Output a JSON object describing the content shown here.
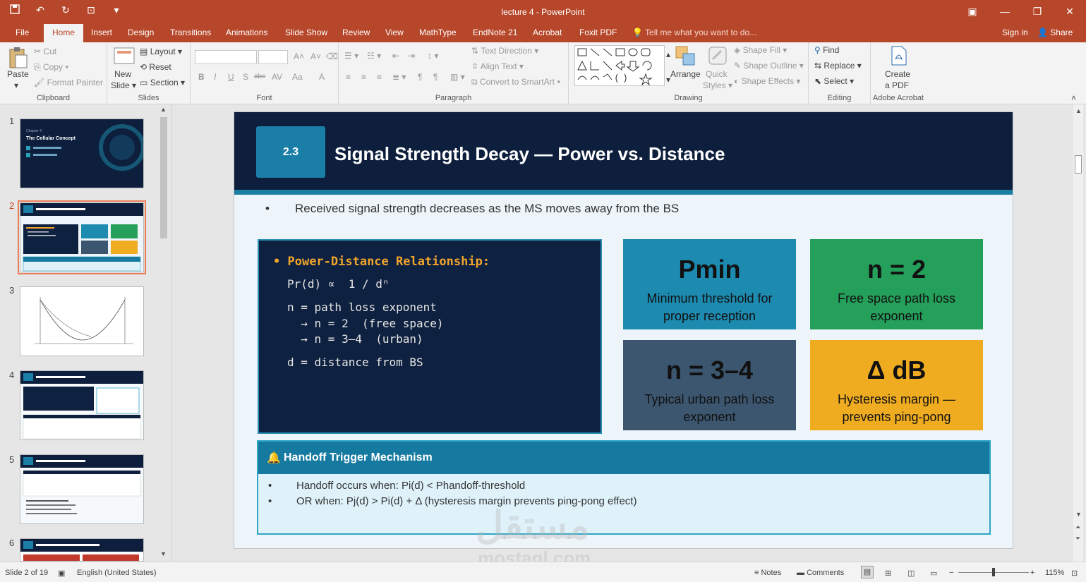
{
  "titlebar": {
    "title": "lecture 4 - PowerPoint",
    "qat": [
      "save-icon",
      "undo-icon",
      "redo-icon",
      "present-icon",
      "customize-icon"
    ]
  },
  "tabs": {
    "items": [
      "File",
      "Home",
      "Insert",
      "Design",
      "Transitions",
      "Animations",
      "Slide Show",
      "Review",
      "View",
      "MathType",
      "EndNote 21",
      "Acrobat",
      "Foxit PDF"
    ],
    "active": "Home",
    "tell_me": "Tell me what you want to do...",
    "sign_in": "Sign in",
    "share": "Share"
  },
  "ribbon": {
    "clipboard": {
      "paste": "Paste",
      "cut": "Cut",
      "copy": "Copy",
      "format_painter": "Format Painter",
      "label": "Clipboard"
    },
    "slides": {
      "new_slide": "New",
      "new_slide2": "Slide",
      "layout": "Layout",
      "reset": "Reset",
      "section": "Section",
      "label": "Slides"
    },
    "font": {
      "label": "Font",
      "b": "B",
      "i": "I",
      "u": "U",
      "s": "S",
      "abc": "abc",
      "av": "AV",
      "aa": "Aa",
      "a": "A"
    },
    "paragraph": {
      "text_direction": "Text Direction",
      "align_text": "Align Text",
      "convert": "Convert to SmartArt",
      "label": "Paragraph"
    },
    "drawing": {
      "arrange": "Arrange",
      "quick": "Quick",
      "styles": "Styles",
      "shape_fill": "Shape Fill",
      "shape_outline": "Shape Outline",
      "shape_effects": "Shape Effects",
      "label": "Drawing"
    },
    "editing": {
      "find": "Find",
      "replace": "Replace",
      "select": "Select",
      "label": "Editing"
    },
    "acrobat": {
      "create": "Create",
      "pdf": "a PDF",
      "label": "Adobe Acrobat"
    }
  },
  "thumbnails": {
    "numbers": [
      "1",
      "2",
      "3",
      "4",
      "5",
      "6"
    ],
    "selected": "2",
    "t1_chapter": "Chapter 4",
    "t1_title": "The Cellular Concept"
  },
  "slide": {
    "section_no": "2.3",
    "title": "Signal Strength Decay — Power vs. Distance",
    "bullet": "Received signal strength decreases as the MS moves away from the BS",
    "code": {
      "heading": "Power-Distance Relationship:",
      "lines": [
        "Pr(d) ∝  1 / dⁿ",
        "n = path loss exponent",
        "  → n = 2  (free space)",
        "  → n = 3–4  (urban)",
        "d = distance from BS"
      ]
    },
    "cards": [
      {
        "big": "Pmin",
        "desc": "Minimum threshold for proper reception",
        "color": "#1d8ab0"
      },
      {
        "big": "n = 2",
        "desc": "Free space path loss exponent",
        "color": "#24a05a"
      },
      {
        "big": "n = 3–4",
        "desc": "Typical urban path loss exponent",
        "color": "#3c5670"
      },
      {
        "big": "Δ dB",
        "desc": "Hysteresis margin — prevents ping-pong",
        "color": "#f0ac20"
      }
    ],
    "handoff": {
      "title": "Handoff Trigger Mechanism",
      "line1": "Handoff occurs when:   Pi(d) < Phandoff-threshold",
      "line2": "OR when:   Pj(d) > Pi(d) + Δ  (hysteresis margin prevents ping-pong effect)"
    }
  },
  "watermark": {
    "arabic": "مستقل",
    "latin": "mostaql.com"
  },
  "status": {
    "slide_of": "Slide 2 of 19",
    "language": "English (United States)",
    "notes": "Notes",
    "comments": "Comments",
    "zoom": "115%"
  }
}
